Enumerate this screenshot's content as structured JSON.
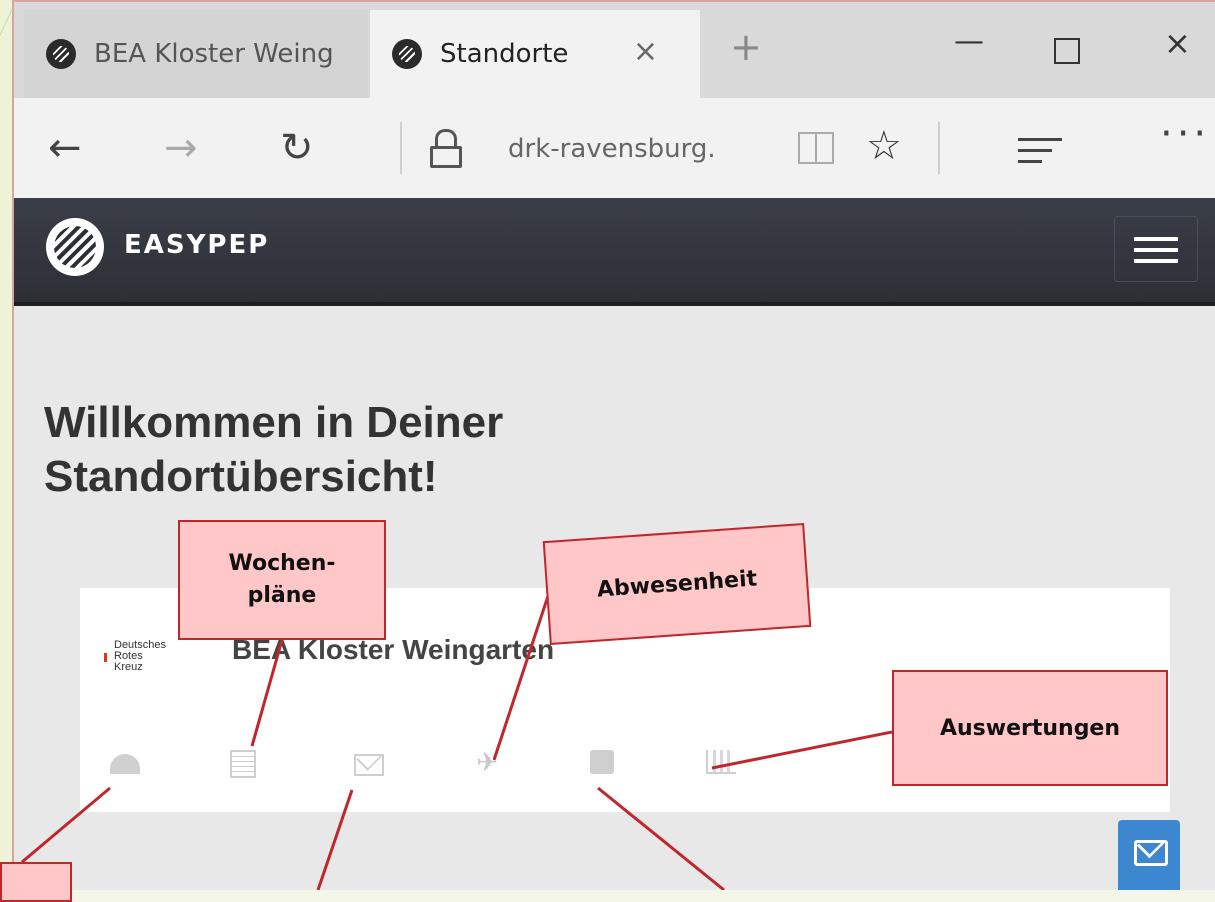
{
  "browser": {
    "tabs": [
      {
        "title": "BEA Kloster Weing",
        "active": false
      },
      {
        "title": "Standorte",
        "active": true
      }
    ],
    "new_tab_label": "+",
    "close_tab_label": "×",
    "address": "drk-ravensburg.",
    "icons": {
      "back": "←",
      "forward": "→",
      "refresh": "↻",
      "favorite": "☆",
      "more": "···",
      "minimize": "—",
      "close": "×"
    }
  },
  "site": {
    "name": "EASYPEP",
    "welcome": "Willkommen in Deiner Standortübersicht!"
  },
  "card": {
    "logo_text": "Deutsches Rotes Kreuz",
    "logo_lines": [
      "Deutsches",
      "Rotes",
      "Kreuz"
    ],
    "title": "BEA Kloster Weingarten",
    "icons": [
      "dashboard-icon",
      "calendar-icon",
      "mail-icon",
      "plane-icon",
      "rss-icon",
      "chart-icon"
    ]
  },
  "callouts": {
    "wochenplaene": "Wochen-\npläne",
    "abwesenheit": "Abwesenheit",
    "auswertungen": "Auswertungen"
  },
  "colors": {
    "callout_fill": "#ffc7c7",
    "callout_border": "#c0272d",
    "site_header": "#2c2f36",
    "mail_button": "#3d86d0"
  }
}
